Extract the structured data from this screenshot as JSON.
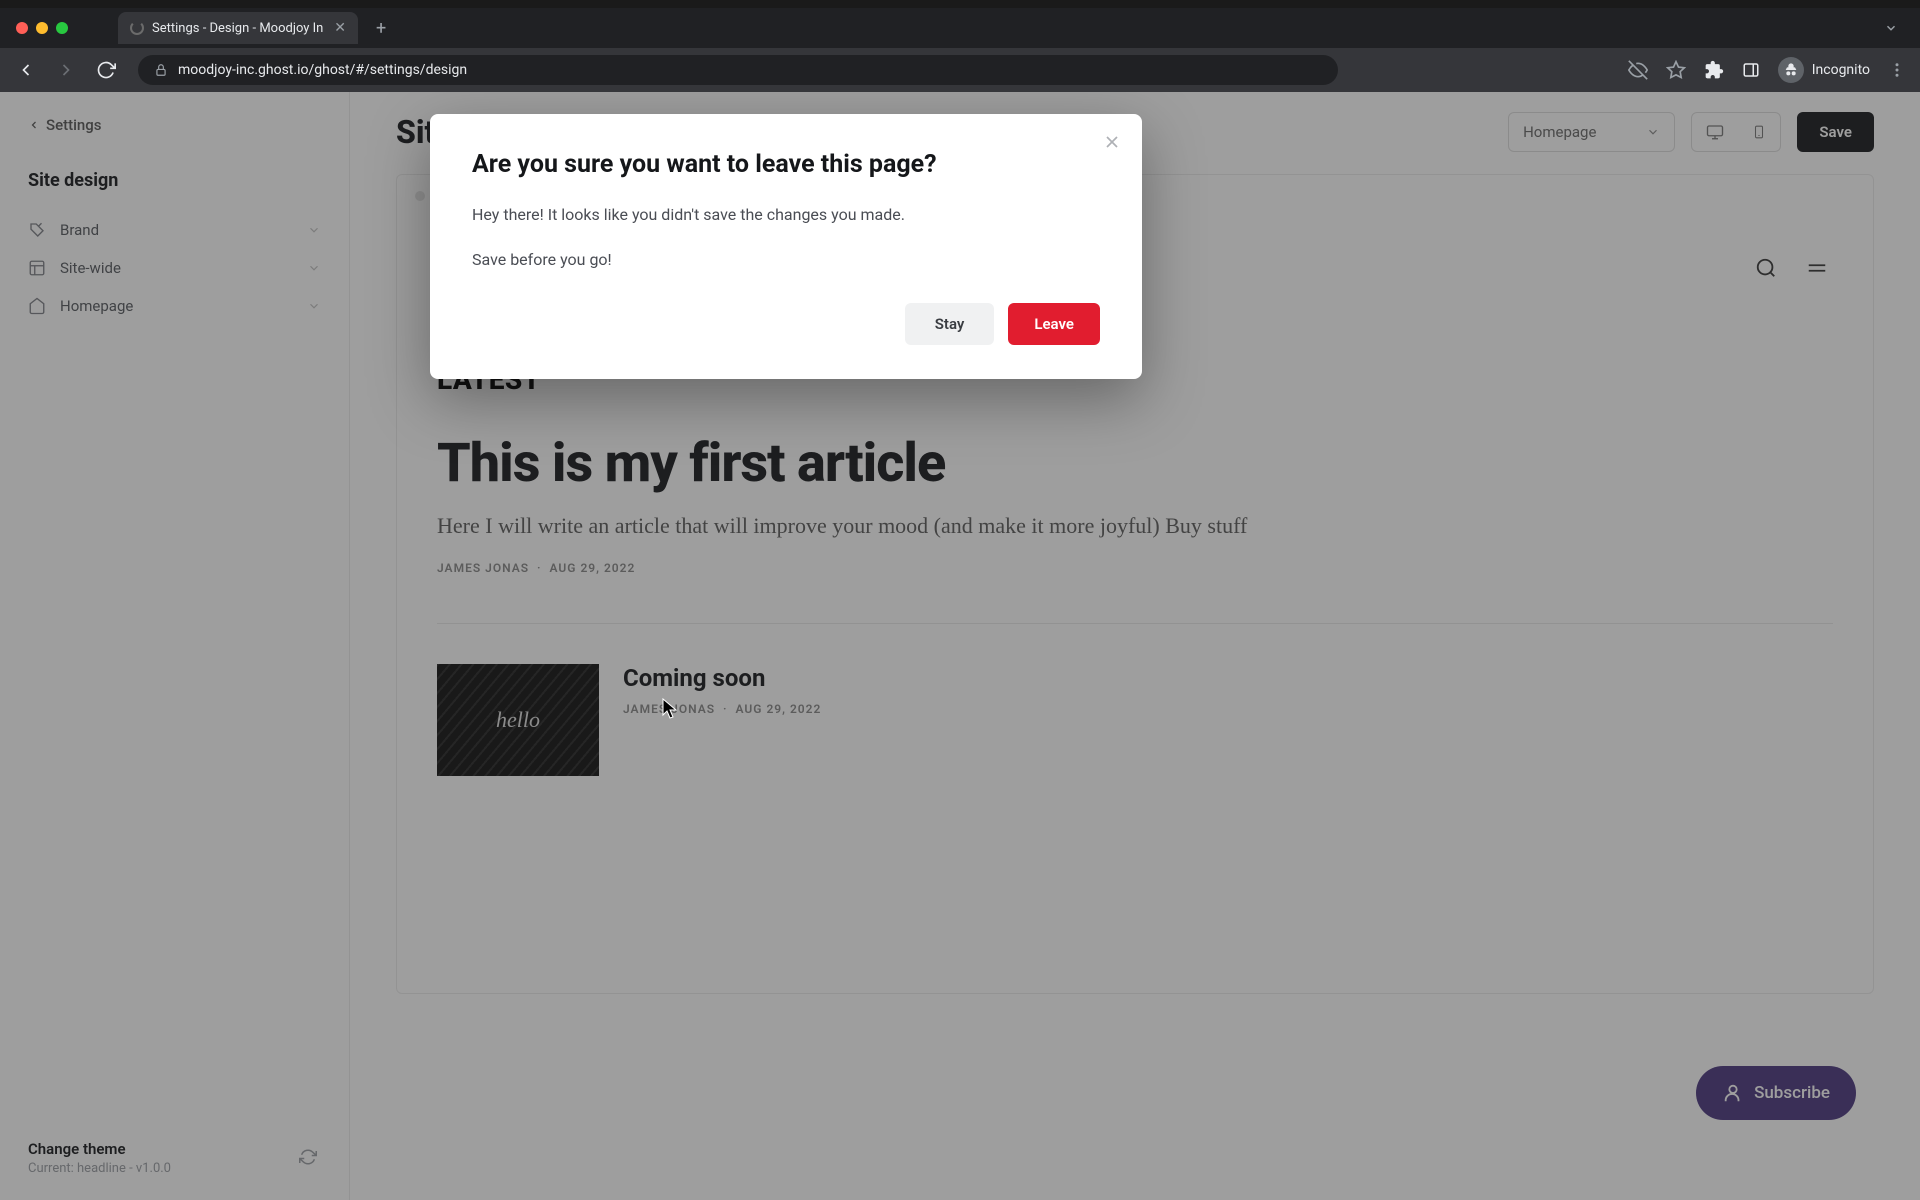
{
  "browser": {
    "tab_title": "Settings - Design - Moodjoy In",
    "url": "moodjoy-inc.ghost.io/ghost/#/settings/design",
    "incognito_label": "Incognito"
  },
  "sidebar": {
    "back_label": "Settings",
    "title": "Site design",
    "items": [
      {
        "label": "Brand"
      },
      {
        "label": "Site-wide"
      },
      {
        "label": "Homepage"
      }
    ],
    "theme": {
      "title": "Change theme",
      "subtitle": "Current: headline - v1.0.0"
    }
  },
  "main": {
    "title": "Site design",
    "page_select": "Homepage",
    "save_label": "Save"
  },
  "preview": {
    "latest_label": "LATEST",
    "article1": {
      "title": "This is my first article",
      "excerpt": "Here I will write an article that will improve your mood (and make it more joyful) Buy stuff",
      "author": "JAMES JONAS",
      "date": "AUG 29, 2022"
    },
    "article2": {
      "thumb_text": "hello",
      "title": "Coming soon",
      "author": "JAMES JONAS",
      "date": "AUG 29, 2022"
    },
    "subscribe_label": "Subscribe"
  },
  "modal": {
    "title": "Are you sure you want to leave this page?",
    "line1": "Hey there! It looks like you didn't save the changes you made.",
    "line2": "Save before you go!",
    "stay_label": "Stay",
    "leave_label": "Leave"
  }
}
